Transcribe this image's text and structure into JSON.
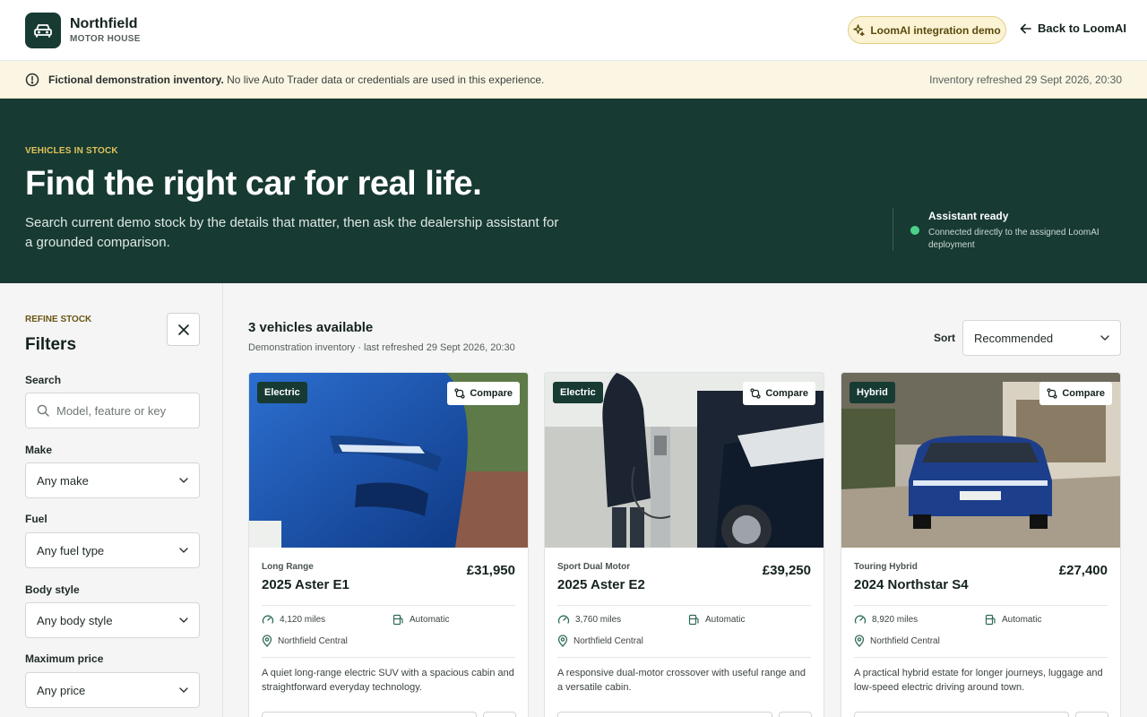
{
  "header": {
    "brand_name": "Northfield",
    "brand_sub": "MOTOR HOUSE",
    "loom_pill": "LoomAI integration demo",
    "back_link": "Back to LoomAI"
  },
  "notice": {
    "bold": "Fictional demonstration inventory.",
    "text": " No live Auto Trader data or credentials are used in this experience.",
    "refreshed": "Inventory refreshed 29 Sept 2026, 20:30"
  },
  "hero": {
    "eyebrow": "VEHICLES IN STOCK",
    "title": "Find the right car for real life.",
    "description": "Search current demo stock by the details that matter, then ask the dealership assistant for a grounded comparison.",
    "assistant_title": "Assistant ready",
    "assistant_sub": "Connected directly to the assigned LoomAI deployment",
    "status_color": "#4cd08a"
  },
  "filters": {
    "eyebrow": "REFINE STOCK",
    "title": "Filters",
    "search_label": "Search",
    "search_placeholder": "Model, feature or key",
    "make_label": "Make",
    "make_value": "Any make",
    "fuel_label": "Fuel",
    "fuel_value": "Any fuel type",
    "body_label": "Body style",
    "body_value": "Any body style",
    "price_label": "Maximum price",
    "price_value": "Any price"
  },
  "results": {
    "count": "3 vehicles available",
    "sub": "Demonstration inventory · last refreshed 29 Sept 2026, 20:30",
    "sort_label": "Sort",
    "sort_value": "Recommended"
  },
  "cars": [
    {
      "badge": "Electric",
      "compare": "Compare",
      "trim": "Long Range",
      "model": "2025 Aster E1",
      "price": "£31,950",
      "miles": "4,120 miles",
      "transmission": "Automatic",
      "location": "Northfield Central",
      "description": "A quiet long-range electric SUV with a spacious cabin and straightforward everyday technology."
    },
    {
      "badge": "Electric",
      "compare": "Compare",
      "trim": "Sport Dual Motor",
      "model": "2025 Aster E2",
      "price": "£39,250",
      "miles": "3,760 miles",
      "transmission": "Automatic",
      "location": "Northfield Central",
      "description": "A responsive dual-motor crossover with useful range and a versatile cabin."
    },
    {
      "badge": "Hybrid",
      "compare": "Compare",
      "trim": "Touring Hybrid",
      "model": "2024 Northstar S4",
      "price": "£27,400",
      "miles": "8,920 miles",
      "transmission": "Automatic",
      "location": "Northfield Central",
      "description": "A practical hybrid estate for longer journeys, luggage and low-speed electric driving around town."
    }
  ],
  "colors": {
    "brand": "#173a33",
    "accent_gold": "#e2c25a",
    "notice_bg": "#fbf6e4"
  }
}
